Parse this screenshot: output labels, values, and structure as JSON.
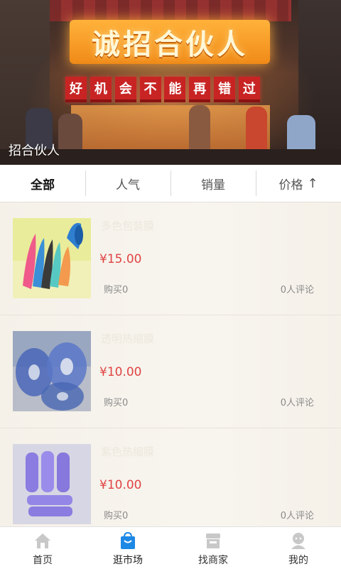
{
  "banner": {
    "main_sign": "诚招合伙人",
    "sub_sign": [
      "好",
      "机",
      "会",
      "不",
      "能",
      "再",
      "错",
      "过"
    ],
    "caption": "招合伙人"
  },
  "sort_tabs": [
    {
      "label": "全部",
      "active": true
    },
    {
      "label": "人气",
      "active": false
    },
    {
      "label": "销量",
      "active": false
    },
    {
      "label": "价格",
      "active": false,
      "icon": "arrow-up-icon",
      "glyph": "↑"
    }
  ],
  "products": [
    {
      "name": "多色包装膜",
      "price": "¥15.00",
      "buy": "购买0",
      "reviews": "0人评论",
      "image": "colorful-film-rolls"
    },
    {
      "name": "透明热缩膜",
      "price": "¥10.00",
      "buy": "购买0",
      "reviews": "0人评论",
      "image": "blue-transparent-film-rolls"
    },
    {
      "name": "紫色热缩膜",
      "price": "¥10.00",
      "buy": "购买0",
      "reviews": "0人评论",
      "image": "purple-film-tubes"
    }
  ],
  "bottom_nav": [
    {
      "label": "首页",
      "icon": "home-icon",
      "active": false
    },
    {
      "label": "逛市场",
      "icon": "shopping-bag-icon",
      "active": true
    },
    {
      "label": "找商家",
      "icon": "store-icon",
      "active": false
    },
    {
      "label": "我的",
      "icon": "user-icon",
      "active": false
    }
  ],
  "colors": {
    "accent": "#1e88e5",
    "price": "#e04444",
    "inactive_icon": "#c8c8c8"
  }
}
